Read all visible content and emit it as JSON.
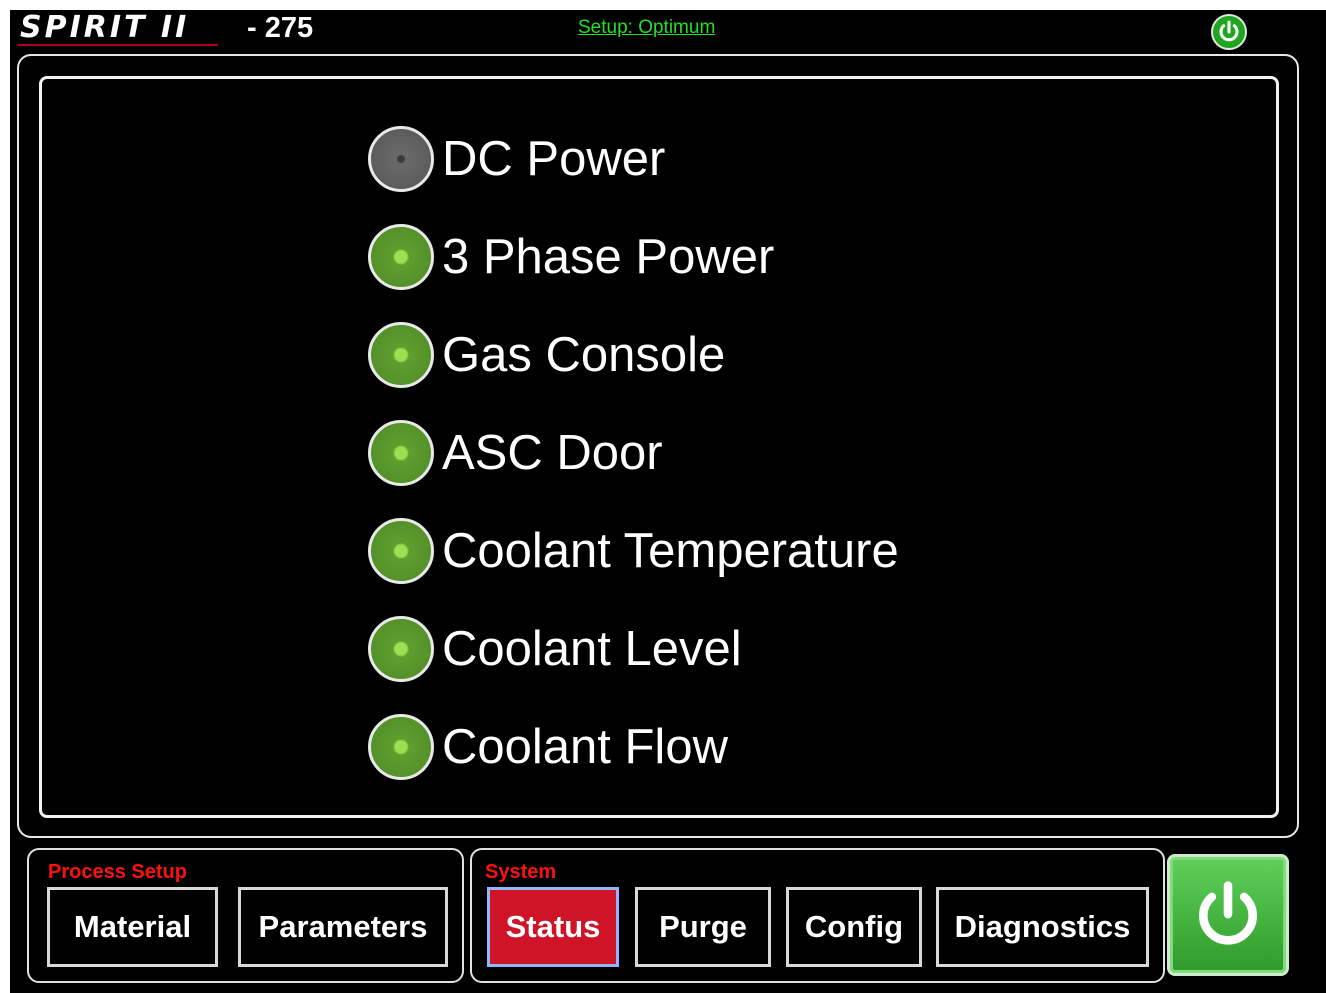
{
  "header": {
    "brand": "SPIRIT II",
    "machine_number": "- 275",
    "setup_link": "Setup: Optimum",
    "power_icon": "power-icon"
  },
  "status_items": [
    {
      "label": "DC Power",
      "state": "off"
    },
    {
      "label": "3 Phase Power",
      "state": "on"
    },
    {
      "label": "Gas Console",
      "state": "on"
    },
    {
      "label": "ASC Door",
      "state": "on"
    },
    {
      "label": "Coolant Temperature",
      "state": "on"
    },
    {
      "label": "Coolant Level",
      "state": "on"
    },
    {
      "label": "Coolant Flow",
      "state": "on"
    }
  ],
  "process_setup": {
    "title": "Process Setup",
    "buttons": [
      "Material",
      "Parameters"
    ]
  },
  "system": {
    "title": "System",
    "buttons": [
      "Status",
      "Purge",
      "Config",
      "Diagnostics"
    ],
    "active": "Status"
  },
  "colors": {
    "led_on": "#5f9e2e",
    "led_off": "#6a6a6a",
    "active_button": "#d01428",
    "group_title": "#ff1010",
    "setup_link": "#22e022",
    "power": "#1fa51f"
  }
}
